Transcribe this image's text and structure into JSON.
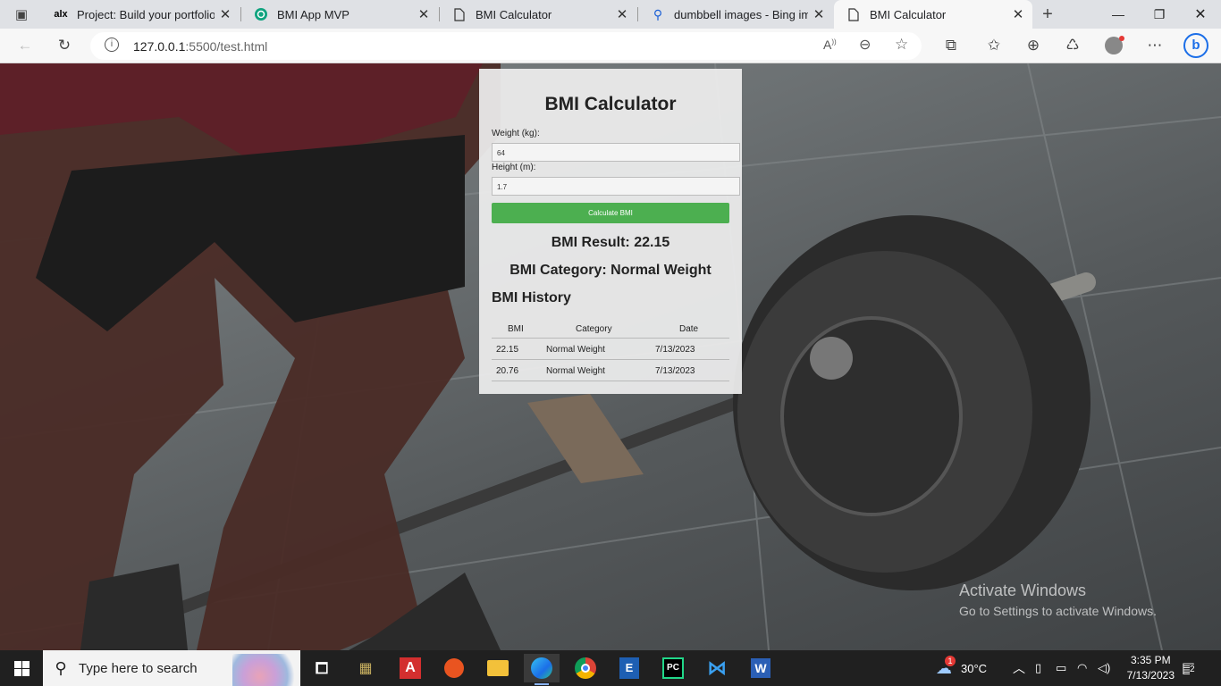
{
  "browser": {
    "tabs": [
      {
        "title": "Project: Build your portfolio p",
        "favicon": "alx-icon",
        "favicon_text": "alx"
      },
      {
        "title": "BMI App MVP",
        "favicon": "chatgpt-icon"
      },
      {
        "title": "BMI Calculator",
        "favicon": "document-icon"
      },
      {
        "title": "dumbbell images - Bing imag",
        "favicon": "search-icon"
      },
      {
        "title": "BMI Calculator",
        "favicon": "document-icon",
        "active": true
      }
    ],
    "address": {
      "host": "127.0.0.1",
      "rest": ":5500/test.html"
    }
  },
  "app": {
    "title": "BMI Calculator",
    "weight_label": "Weight (kg):",
    "weight_value": "64",
    "height_label": "Height (m):",
    "height_value": "1.7",
    "button_label": "Calculate BMI",
    "result_text": "BMI Result: 22.15",
    "category_text": "BMI Category: Normal Weight",
    "history_title": "BMI History",
    "history_headers": [
      "BMI",
      "Category",
      "Date"
    ],
    "history_rows": [
      [
        "22.15",
        "Normal Weight",
        "7/13/2023"
      ],
      [
        "20.76",
        "Normal Weight",
        "7/13/2023"
      ]
    ],
    "accent_color": "#4caf50"
  },
  "watermark": {
    "line1": "Activate Windows",
    "line2": "Go to Settings to activate Windows."
  },
  "taskbar": {
    "search_placeholder": "Type here to search",
    "weather": "30°C",
    "weather_badge": "1",
    "time": "3:35 PM",
    "date": "7/13/2023",
    "notifications": "2"
  }
}
